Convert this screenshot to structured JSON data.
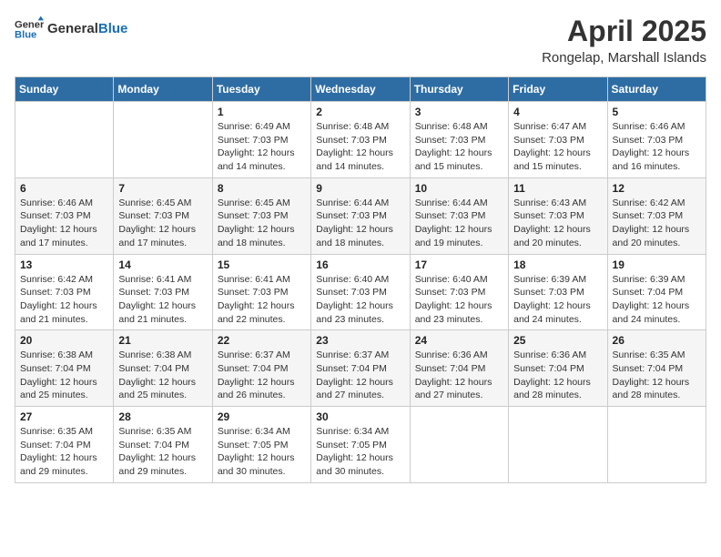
{
  "header": {
    "logo_line1": "General",
    "logo_line2": "Blue",
    "month": "April 2025",
    "location": "Rongelap, Marshall Islands"
  },
  "weekdays": [
    "Sunday",
    "Monday",
    "Tuesday",
    "Wednesday",
    "Thursday",
    "Friday",
    "Saturday"
  ],
  "weeks": [
    [
      {
        "day": "",
        "detail": ""
      },
      {
        "day": "",
        "detail": ""
      },
      {
        "day": "1",
        "detail": "Sunrise: 6:49 AM\nSunset: 7:03 PM\nDaylight: 12 hours\nand 14 minutes."
      },
      {
        "day": "2",
        "detail": "Sunrise: 6:48 AM\nSunset: 7:03 PM\nDaylight: 12 hours\nand 14 minutes."
      },
      {
        "day": "3",
        "detail": "Sunrise: 6:48 AM\nSunset: 7:03 PM\nDaylight: 12 hours\nand 15 minutes."
      },
      {
        "day": "4",
        "detail": "Sunrise: 6:47 AM\nSunset: 7:03 PM\nDaylight: 12 hours\nand 15 minutes."
      },
      {
        "day": "5",
        "detail": "Sunrise: 6:46 AM\nSunset: 7:03 PM\nDaylight: 12 hours\nand 16 minutes."
      }
    ],
    [
      {
        "day": "6",
        "detail": "Sunrise: 6:46 AM\nSunset: 7:03 PM\nDaylight: 12 hours\nand 17 minutes."
      },
      {
        "day": "7",
        "detail": "Sunrise: 6:45 AM\nSunset: 7:03 PM\nDaylight: 12 hours\nand 17 minutes."
      },
      {
        "day": "8",
        "detail": "Sunrise: 6:45 AM\nSunset: 7:03 PM\nDaylight: 12 hours\nand 18 minutes."
      },
      {
        "day": "9",
        "detail": "Sunrise: 6:44 AM\nSunset: 7:03 PM\nDaylight: 12 hours\nand 18 minutes."
      },
      {
        "day": "10",
        "detail": "Sunrise: 6:44 AM\nSunset: 7:03 PM\nDaylight: 12 hours\nand 19 minutes."
      },
      {
        "day": "11",
        "detail": "Sunrise: 6:43 AM\nSunset: 7:03 PM\nDaylight: 12 hours\nand 20 minutes."
      },
      {
        "day": "12",
        "detail": "Sunrise: 6:42 AM\nSunset: 7:03 PM\nDaylight: 12 hours\nand 20 minutes."
      }
    ],
    [
      {
        "day": "13",
        "detail": "Sunrise: 6:42 AM\nSunset: 7:03 PM\nDaylight: 12 hours\nand 21 minutes."
      },
      {
        "day": "14",
        "detail": "Sunrise: 6:41 AM\nSunset: 7:03 PM\nDaylight: 12 hours\nand 21 minutes."
      },
      {
        "day": "15",
        "detail": "Sunrise: 6:41 AM\nSunset: 7:03 PM\nDaylight: 12 hours\nand 22 minutes."
      },
      {
        "day": "16",
        "detail": "Sunrise: 6:40 AM\nSunset: 7:03 PM\nDaylight: 12 hours\nand 23 minutes."
      },
      {
        "day": "17",
        "detail": "Sunrise: 6:40 AM\nSunset: 7:03 PM\nDaylight: 12 hours\nand 23 minutes."
      },
      {
        "day": "18",
        "detail": "Sunrise: 6:39 AM\nSunset: 7:03 PM\nDaylight: 12 hours\nand 24 minutes."
      },
      {
        "day": "19",
        "detail": "Sunrise: 6:39 AM\nSunset: 7:04 PM\nDaylight: 12 hours\nand 24 minutes."
      }
    ],
    [
      {
        "day": "20",
        "detail": "Sunrise: 6:38 AM\nSunset: 7:04 PM\nDaylight: 12 hours\nand 25 minutes."
      },
      {
        "day": "21",
        "detail": "Sunrise: 6:38 AM\nSunset: 7:04 PM\nDaylight: 12 hours\nand 25 minutes."
      },
      {
        "day": "22",
        "detail": "Sunrise: 6:37 AM\nSunset: 7:04 PM\nDaylight: 12 hours\nand 26 minutes."
      },
      {
        "day": "23",
        "detail": "Sunrise: 6:37 AM\nSunset: 7:04 PM\nDaylight: 12 hours\nand 27 minutes."
      },
      {
        "day": "24",
        "detail": "Sunrise: 6:36 AM\nSunset: 7:04 PM\nDaylight: 12 hours\nand 27 minutes."
      },
      {
        "day": "25",
        "detail": "Sunrise: 6:36 AM\nSunset: 7:04 PM\nDaylight: 12 hours\nand 28 minutes."
      },
      {
        "day": "26",
        "detail": "Sunrise: 6:35 AM\nSunset: 7:04 PM\nDaylight: 12 hours\nand 28 minutes."
      }
    ],
    [
      {
        "day": "27",
        "detail": "Sunrise: 6:35 AM\nSunset: 7:04 PM\nDaylight: 12 hours\nand 29 minutes."
      },
      {
        "day": "28",
        "detail": "Sunrise: 6:35 AM\nSunset: 7:04 PM\nDaylight: 12 hours\nand 29 minutes."
      },
      {
        "day": "29",
        "detail": "Sunrise: 6:34 AM\nSunset: 7:05 PM\nDaylight: 12 hours\nand 30 minutes."
      },
      {
        "day": "30",
        "detail": "Sunrise: 6:34 AM\nSunset: 7:05 PM\nDaylight: 12 hours\nand 30 minutes."
      },
      {
        "day": "",
        "detail": ""
      },
      {
        "day": "",
        "detail": ""
      },
      {
        "day": "",
        "detail": ""
      }
    ]
  ]
}
